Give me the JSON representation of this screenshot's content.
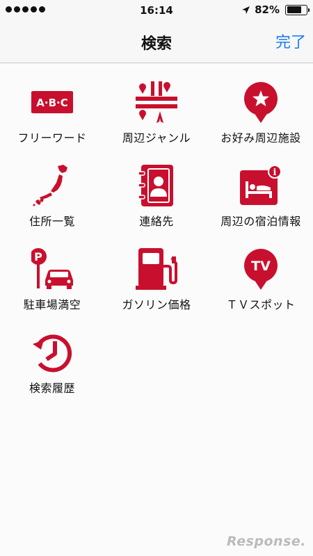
{
  "status_bar": {
    "time": "16:14",
    "battery": "82%",
    "battery_level": 0.82
  },
  "nav": {
    "title": "検索",
    "done_label": "完了"
  },
  "menu": [
    {
      "label": "フリーワード",
      "icon": "abc-keyword-icon",
      "icon_text": "A·B·C"
    },
    {
      "label": "周辺ジャンル",
      "icon": "nearby-genre-icon"
    },
    {
      "label": "お好み周辺施設",
      "icon": "favorite-facility-pin-icon"
    },
    {
      "label": "住所一覧",
      "icon": "japan-map-icon"
    },
    {
      "label": "連絡先",
      "icon": "contacts-book-icon"
    },
    {
      "label": "周辺の宿泊情報",
      "icon": "hotel-bed-icon",
      "icon_text": "i"
    },
    {
      "label": "駐車場満空",
      "icon": "parking-car-icon",
      "icon_text": "P"
    },
    {
      "label": "ガソリン価格",
      "icon": "gas-pump-icon"
    },
    {
      "label": "ＴＶスポット",
      "icon": "tv-pin-icon",
      "icon_text": "TV"
    },
    {
      "label": "検索履歴",
      "icon": "history-clock-icon"
    }
  ],
  "colors": {
    "accent_red": "#c8102e",
    "link_blue": "#1a7cf3"
  },
  "watermark": "Response."
}
